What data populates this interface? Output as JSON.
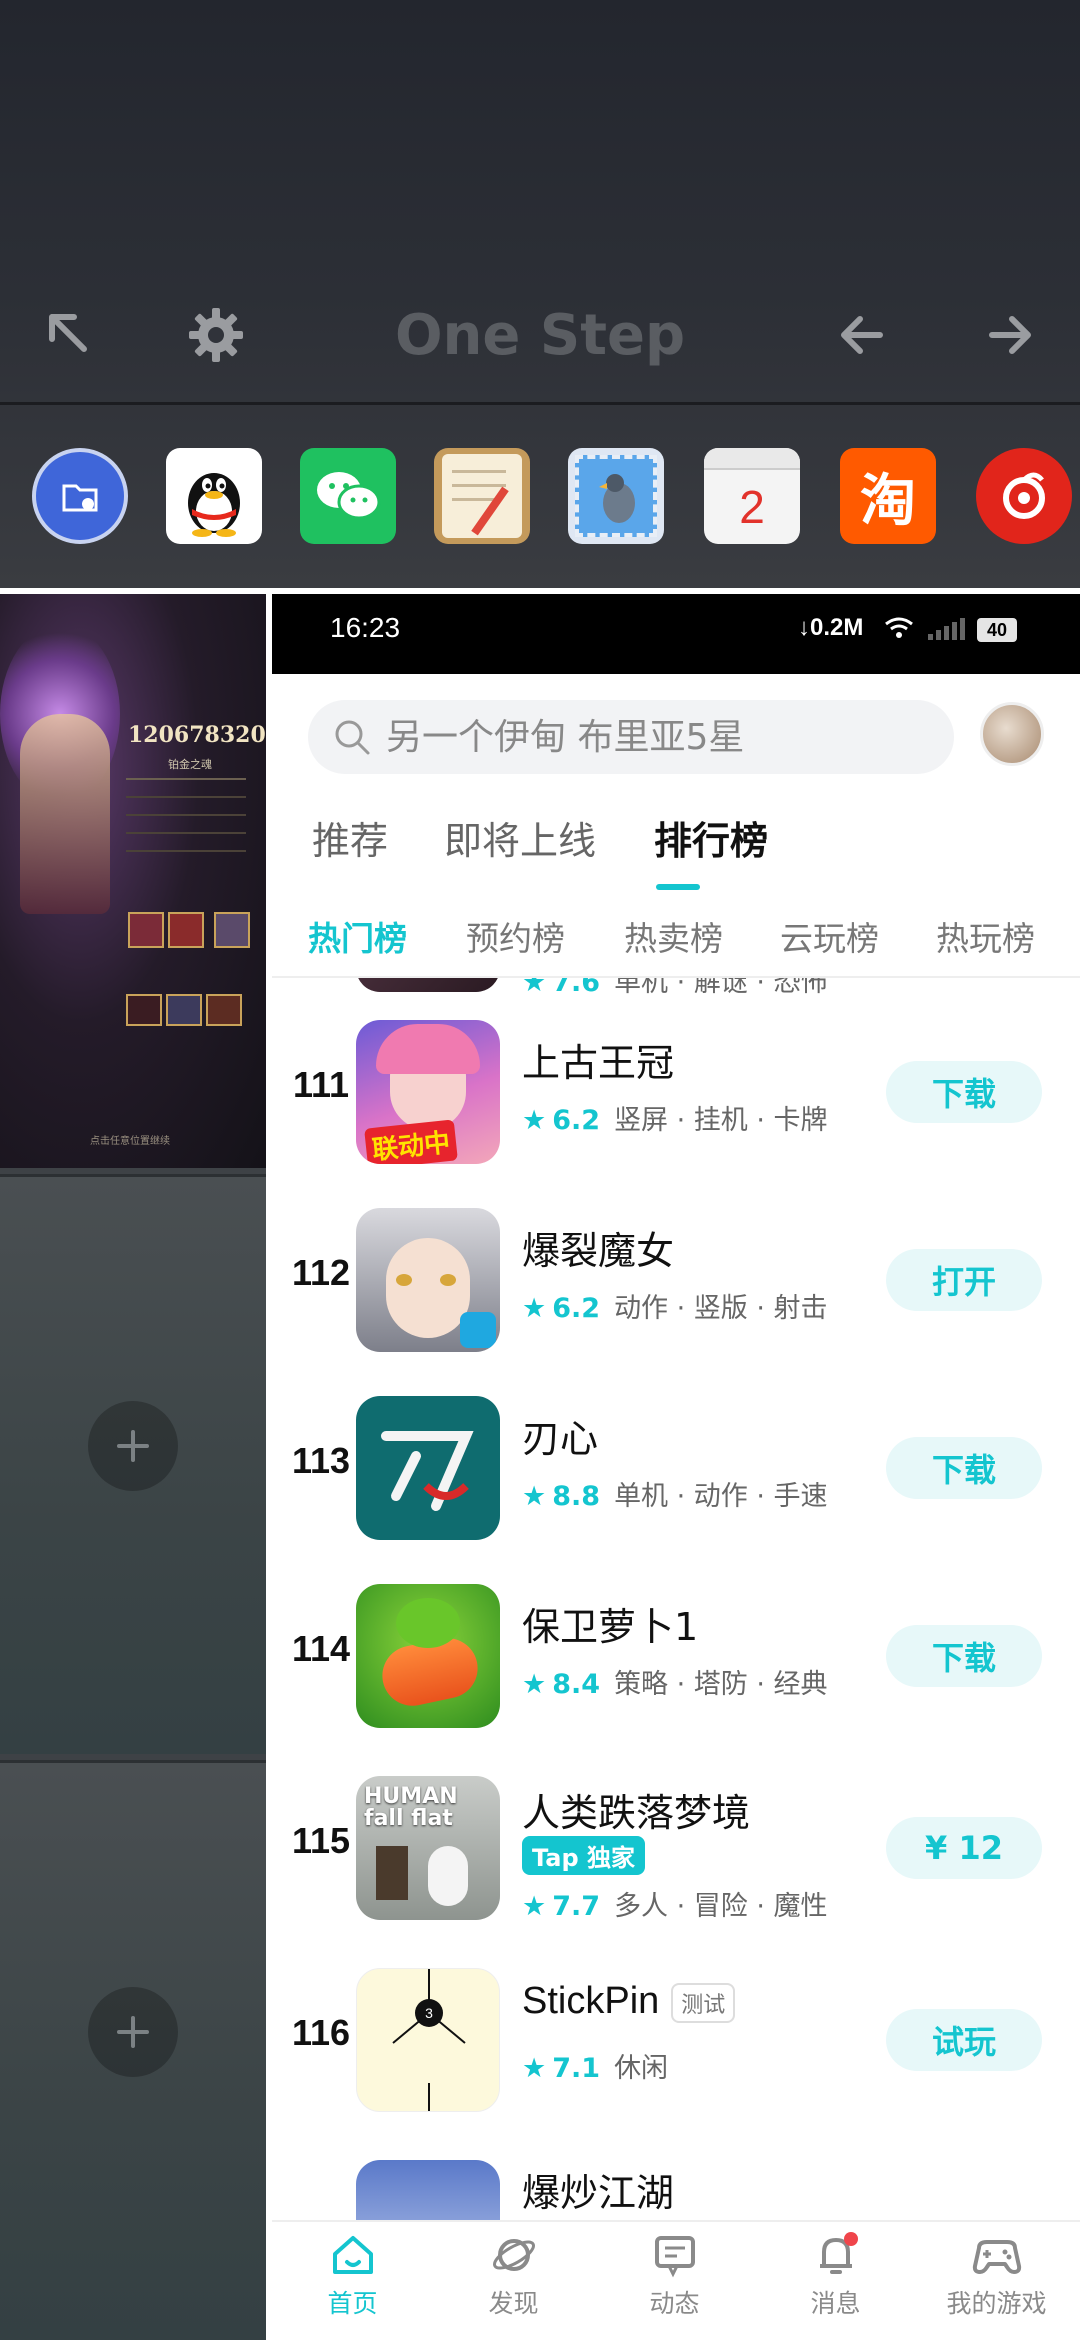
{
  "launcher": {
    "title": "One Step",
    "toolbar_icons": [
      "expand-arrow-icon",
      "settings-icon",
      "back-arrow-icon",
      "forward-arrow-icon"
    ],
    "dock_apps": [
      "file-manager",
      "qq",
      "wechat",
      "notes",
      "mail",
      "calendar",
      "taobao",
      "netease-music"
    ],
    "calendar_day": "2",
    "taobao_label": "淘"
  },
  "left_panel": {
    "screenshot": {
      "score": "120678320",
      "subtitle": "铂金之魂",
      "footer": "点击任意位置继续"
    },
    "add_icons": [
      "plus-icon",
      "plus-icon"
    ]
  },
  "status_bar": {
    "time": "16:23",
    "network": "0.2M",
    "battery": "40"
  },
  "search": {
    "placeholder": "另一个伊甸 布里亚5星"
  },
  "tabs": [
    "推荐",
    "即将上线",
    "排行榜"
  ],
  "active_tab": "排行榜",
  "subtabs": [
    "热门榜",
    "预约榜",
    "热卖榜",
    "云玩榜",
    "热玩榜"
  ],
  "active_subtab": "热门榜",
  "partial_prev_row": {
    "score": "7.6",
    "tags": "单机 · 解谜 · 恐怖"
  },
  "games": [
    {
      "rank": "111",
      "name": "上古王冠",
      "score": "6.2",
      "tags": "竖屏 · 挂机 · 卡牌",
      "action": "下载",
      "icon_badge": "联动中"
    },
    {
      "rank": "112",
      "name": "爆裂魔女",
      "score": "6.2",
      "tags": "动作 · 竖版 · 射击",
      "action": "打开",
      "icon_badge": ""
    },
    {
      "rank": "113",
      "name": "刃心",
      "score": "8.8",
      "tags": "单机 · 动作 · 手速",
      "action": "下载",
      "icon_badge": ""
    },
    {
      "rank": "114",
      "name": "保卫萝卜1",
      "score": "8.4",
      "tags": "策略 · 塔防 · 经典",
      "action": "下载",
      "icon_badge": ""
    },
    {
      "rank": "115",
      "name": "人类跌落梦境",
      "score": "7.7",
      "tags": "多人 · 冒险 · 魔性",
      "action": "¥ 12",
      "badge": "Tap 独家",
      "icon_badge": "HUMAN fall flat"
    },
    {
      "rank": "116",
      "name": "StickPin",
      "score": "7.1",
      "tags": "休闲",
      "action": "试玩",
      "test_tag": "测试",
      "icon_badge": "3"
    },
    {
      "rank": "",
      "name": "爆炒江湖",
      "score": "",
      "tags": "",
      "action": ""
    }
  ],
  "bottom_nav": [
    {
      "label": "首页",
      "icon": "home-icon"
    },
    {
      "label": "发现",
      "icon": "planet-icon"
    },
    {
      "label": "动态",
      "icon": "message-board-icon"
    },
    {
      "label": "消息",
      "icon": "bell-icon"
    },
    {
      "label": "我的游戏",
      "icon": "gamepad-icon"
    }
  ],
  "colors": {
    "accent": "#14c5cf",
    "notification_dot": "#f0454b"
  }
}
